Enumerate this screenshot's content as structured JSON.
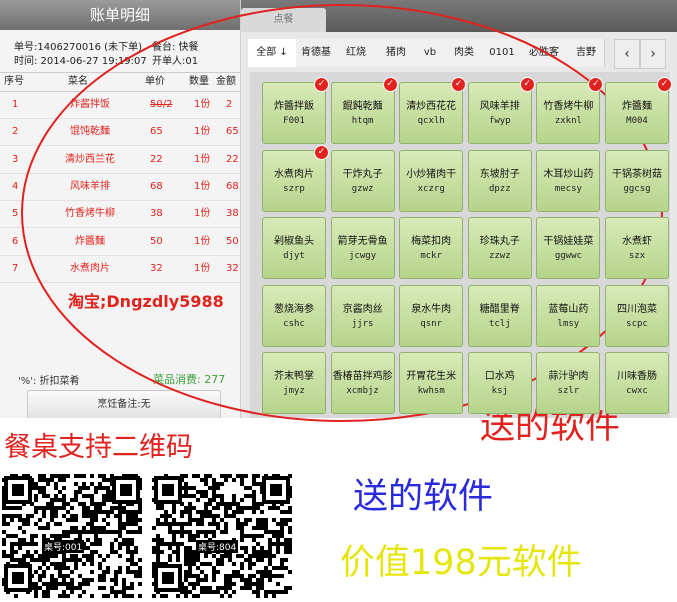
{
  "bill": {
    "title": "账单明细",
    "order_no": "单号:1406270016 (未下单)",
    "order_type": "餐台: 快餐",
    "time": "时间: 2014-06-27 19:19:07",
    "opener": "开单人:01",
    "columns": [
      "序号",
      "菜名",
      "单价",
      "数量",
      "金额"
    ],
    "rows": [
      {
        "no": "1",
        "name": "炸酱拌饭",
        "price": "50/2",
        "qty": "1份",
        "amount": "2"
      },
      {
        "no": "2",
        "name": "馄饨乾麵",
        "price": "65",
        "qty": "1份",
        "amount": "65"
      },
      {
        "no": "3",
        "name": "清炒西兰花",
        "price": "22",
        "qty": "1份",
        "amount": "22"
      },
      {
        "no": "4",
        "name": "风味羊排",
        "price": "68",
        "qty": "1份",
        "amount": "68"
      },
      {
        "no": "5",
        "name": "竹香烤牛柳",
        "price": "38",
        "qty": "1份",
        "amount": "38"
      },
      {
        "no": "6",
        "name": "炸醬麵",
        "price": "50",
        "qty": "1份",
        "amount": "50"
      },
      {
        "no": "7",
        "name": "水煮肉片",
        "price": "32",
        "qty": "1份",
        "amount": "32"
      }
    ],
    "taobao": "淘宝;Dngzdly5988",
    "discount_note": "'%': 折扣菜肴",
    "member_spend": "菜品消费: 277",
    "remark": "烹饪备注:无"
  },
  "tabs": {
    "order": "点餐"
  },
  "categories": [
    "全部 ↓",
    "肯德基",
    "红烧",
    "猪肉",
    "vb",
    "肉类",
    "0101",
    "必胜客",
    "吉野"
  ],
  "nav": {
    "prev": "‹",
    "next": "›"
  },
  "dishes": [
    {
      "name": "炸醬拌飯",
      "code": "F001",
      "selected": true
    },
    {
      "name": "餛飩乾麵",
      "code": "htqm",
      "selected": true
    },
    {
      "name": "清炒西花花",
      "code": "qcxlh",
      "selected": true
    },
    {
      "name": "风味羊排",
      "code": "fwyp",
      "selected": true
    },
    {
      "name": "竹香烤牛柳",
      "code": "zxknl",
      "selected": true
    },
    {
      "name": "炸醬麵",
      "code": "M004",
      "selected": true
    },
    {
      "name": "水煮肉片",
      "code": "szrp",
      "selected": true
    },
    {
      "name": "干炸丸子",
      "code": "gzwz",
      "selected": false
    },
    {
      "name": "小炒猪肉干",
      "code": "xczrg",
      "selected": false
    },
    {
      "name": "东坡肘子",
      "code": "dpzz",
      "selected": false
    },
    {
      "name": "木耳炒山药",
      "code": "mecsy",
      "selected": false
    },
    {
      "name": "干锅茶树菇",
      "code": "ggcsg",
      "selected": false
    },
    {
      "name": "剁椒鱼头",
      "code": "djyt",
      "selected": false
    },
    {
      "name": "箭芽无骨鱼",
      "code": "jcwgy",
      "selected": false
    },
    {
      "name": "梅菜扣肉",
      "code": "mckr",
      "selected": false
    },
    {
      "name": "珍珠丸子",
      "code": "zzwz",
      "selected": false
    },
    {
      "name": "干锅娃娃菜",
      "code": "ggwwc",
      "selected": false
    },
    {
      "name": "水煮虾",
      "code": "szx",
      "selected": false
    },
    {
      "name": "葱烧海参",
      "code": "cshc",
      "selected": false
    },
    {
      "name": "京酱肉丝",
      "code": "jjrs",
      "selected": false
    },
    {
      "name": "泉水牛肉",
      "code": "qsnr",
      "selected": false
    },
    {
      "name": "糖醋里脊",
      "code": "tclj",
      "selected": false
    },
    {
      "name": "蓝莓山药",
      "code": "lmsy",
      "selected": false
    },
    {
      "name": "四川泡菜",
      "code": "scpc",
      "selected": false
    },
    {
      "name": "芥末鸭掌",
      "code": "jmyz",
      "selected": false
    },
    {
      "name": "香椿苗拌鸡胗",
      "code": "xcmbjz",
      "selected": false
    },
    {
      "name": "开胃花生米",
      "code": "kwhsm",
      "selected": false
    },
    {
      "name": "口水鸡",
      "code": "ksj",
      "selected": false
    },
    {
      "name": "蒜汁驴肉",
      "code": "szlr",
      "selected": false
    },
    {
      "name": "川味香肠",
      "code": "cwxc",
      "selected": false
    }
  ],
  "promo": {
    "qr_title": "餐桌支持二维码",
    "line1": "送的软件",
    "line2": "送的软件",
    "line3": "价值198元软件",
    "qr1_label": "桌号:001",
    "qr2_label": "桌号:804"
  }
}
